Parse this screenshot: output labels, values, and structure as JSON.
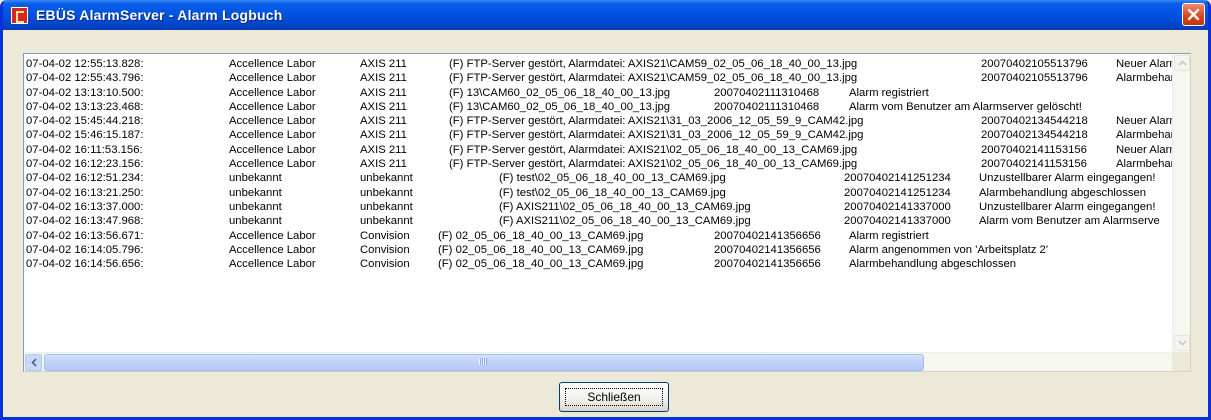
{
  "window": {
    "title": "EBÜS AlarmServer - Alarm Logbuch",
    "close_icon": "close-x-icon"
  },
  "log_entries": [
    {
      "time": "07-04-02 12:55:13.828:",
      "location": "Accellence Labor",
      "camera": "AXIS 211",
      "message": "(F) FTP-Server gestört, Alarmdatei: AXIS21\\CAM59_02_05_06_18_40_00_13.jpg",
      "alarm_id": "20070402105513796",
      "status": "Neuer Alarm e"
    },
    {
      "time": "07-04-02 12:55:43.796:",
      "location": "Accellence Labor",
      "camera": "AXIS 211",
      "message": "(F) FTP-Server gestört, Alarmdatei: AXIS21\\CAM59_02_05_06_18_40_00_13.jpg",
      "alarm_id": "20070402105513796",
      "status": "Alarmbehand"
    },
    {
      "time": "07-04-02 13:13:10.500:",
      "location": "Accellence Labor",
      "camera": "AXIS 211",
      "message": "(F) 13\\CAM60_02_05_06_18_40_00_13.jpg",
      "alarm_id": "20070402111310468",
      "status": "Alarm registriert"
    },
    {
      "time": "07-04-02 13:13:23.468:",
      "location": "Accellence Labor",
      "camera": "AXIS 211",
      "message": "(F) 13\\CAM60_02_05_06_18_40_00_13.jpg",
      "alarm_id": "20070402111310468",
      "status": "Alarm vom Benutzer am Alarmserver gelöscht!"
    },
    {
      "time": "07-04-02 15:45:44.218:",
      "location": "Accellence Labor",
      "camera": "AXIS 211",
      "message": "(F) FTP-Server gestört, Alarmdatei: AXIS21\\31_03_2006_12_05_59_9_CAM42.jpg",
      "alarm_id": "20070402134544218",
      "status": "Neuer Alarm e"
    },
    {
      "time": "07-04-02 15:46:15.187:",
      "location": "Accellence Labor",
      "camera": "AXIS 211",
      "message": "(F) FTP-Server gestört, Alarmdatei: AXIS21\\31_03_2006_12_05_59_9_CAM42.jpg",
      "alarm_id": "20070402134544218",
      "status": "Alarmbehand"
    },
    {
      "time": "07-04-02 16:11:53.156:",
      "location": "Accellence Labor",
      "camera": "AXIS 211",
      "message": "(F) FTP-Server gestört, Alarmdatei: AXIS21\\02_05_06_18_40_00_13_CAM69.jpg",
      "alarm_id": "20070402141153156",
      "status": "Neuer Alarm e"
    },
    {
      "time": "07-04-02 16:12:23.156:",
      "location": "Accellence Labor",
      "camera": "AXIS 211",
      "message": "(F) FTP-Server gestört, Alarmdatei: AXIS21\\02_05_06_18_40_00_13_CAM69.jpg",
      "alarm_id": "20070402141153156",
      "status": "Alarmbehand"
    },
    {
      "time": "07-04-02 16:12:51.234:",
      "location": "unbekannt",
      "camera": "unbekannt",
      "message": "(F) test\\02_05_06_18_40_00_13_CAM69.jpg",
      "alarm_id": "20070402141251234",
      "status": "Unzustellbarer Alarm eingegangen!"
    },
    {
      "time": "07-04-02 16:13:21.250:",
      "location": "unbekannt",
      "camera": "unbekannt",
      "message": "(F) test\\02_05_06_18_40_00_13_CAM69.jpg",
      "alarm_id": "20070402141251234",
      "status": "Alarmbehandlung abgeschlossen"
    },
    {
      "time": "07-04-02 16:13:37.000:",
      "location": "unbekannt",
      "camera": "unbekannt",
      "message": "(F) AXIS211\\02_05_06_18_40_00_13_CAM69.jpg",
      "alarm_id": "20070402141337000",
      "status": "Unzustellbarer Alarm eingegangen!"
    },
    {
      "time": "07-04-02 16:13:47.968:",
      "location": "unbekannt",
      "camera": "unbekannt",
      "message": "(F) AXIS211\\02_05_06_18_40_00_13_CAM69.jpg",
      "alarm_id": "20070402141337000",
      "status": "Alarm vom Benutzer am Alarmserve"
    },
    {
      "time": "07-04-02 16:13:56.671:",
      "location": "Accellence Labor",
      "camera": "Convision",
      "message": "(F) 02_05_06_18_40_00_13_CAM69.jpg",
      "alarm_id": "20070402141356656",
      "status": "Alarm registriert"
    },
    {
      "time": "07-04-02 16:14:05.796:",
      "location": "Accellence Labor",
      "camera": "Convision",
      "message": "(F) 02_05_06_18_40_00_13_CAM69.jpg",
      "alarm_id": "20070402141356656",
      "status": "Alarm angenommen von 'Arbeitsplatz 2'"
    },
    {
      "time": "07-04-02 16:14:56.656:",
      "location": "Accellence Labor",
      "camera": "Convision",
      "message": "(F) 02_05_06_18_40_00_13_CAM69.jpg",
      "alarm_id": "20070402141356656",
      "status": "Alarmbehandlung abgeschlossen"
    }
  ],
  "footer": {
    "close_label": "Schließen"
  }
}
